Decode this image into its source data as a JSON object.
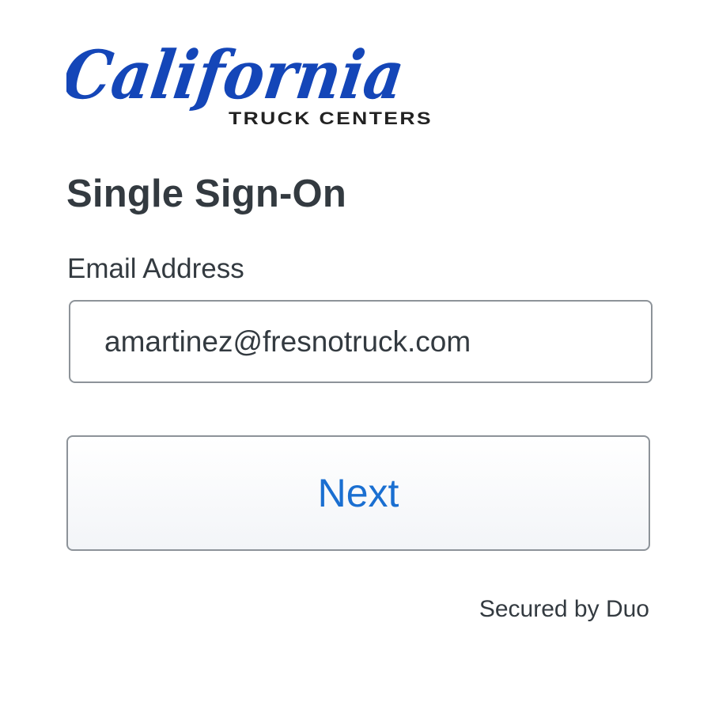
{
  "logo": {
    "script_text": "California",
    "sub_text": "TRUCK CENTERS",
    "script_color": "#1446b8",
    "sub_color": "#222222"
  },
  "page": {
    "title": "Single Sign-On"
  },
  "form": {
    "email_label": "Email Address",
    "email_value": "amartinez@fresnotruck.com",
    "next_label": "Next"
  },
  "footer": {
    "secured_text": "Secured by Duo"
  },
  "colors": {
    "accent": "#1a6fd1",
    "text": "#333a40",
    "border": "#8d9399"
  }
}
